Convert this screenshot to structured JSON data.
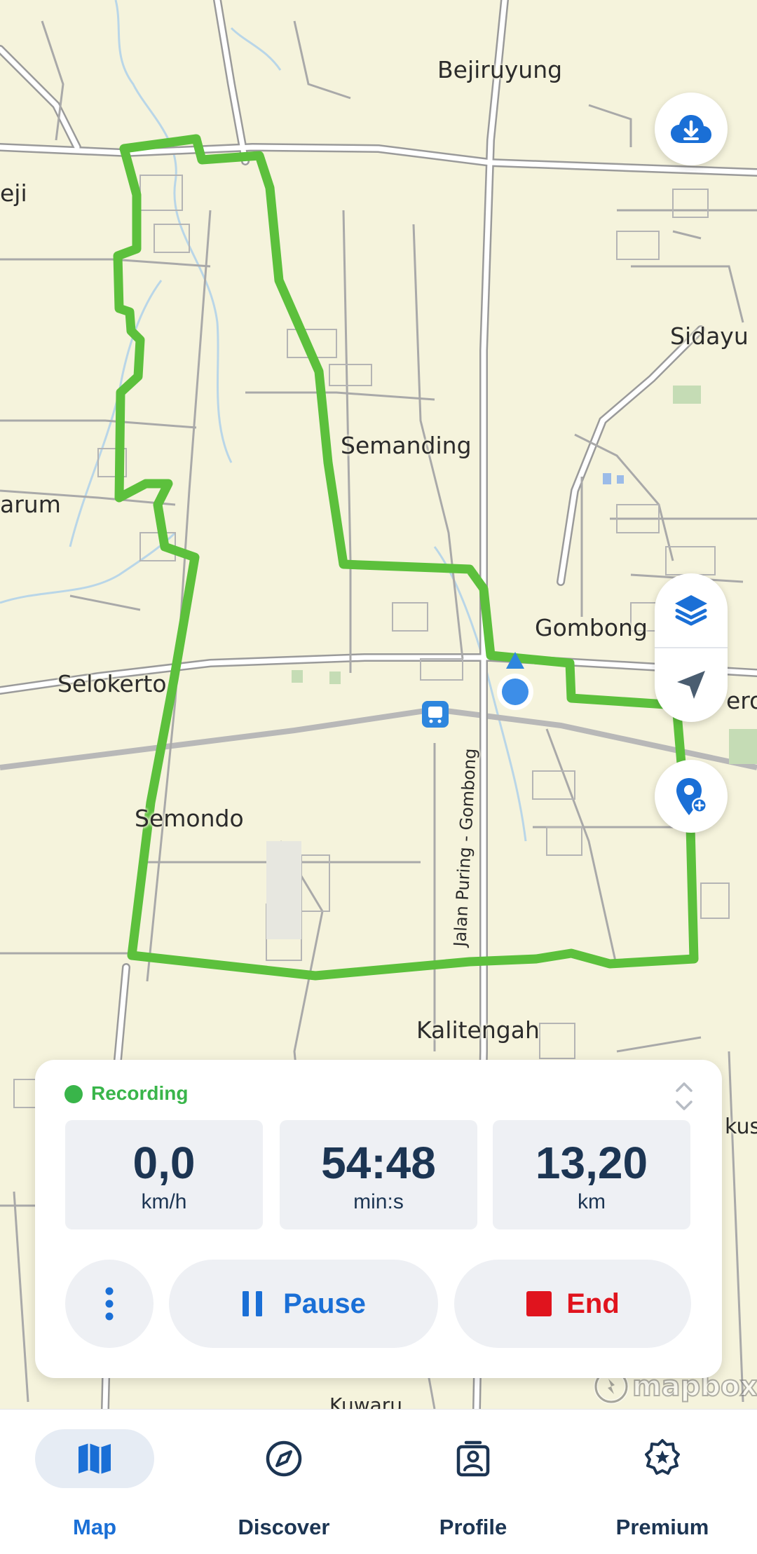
{
  "map": {
    "labels": {
      "bejiruyung": "Bejiruyung",
      "eji": "eji",
      "sidayu": "Sidayu",
      "semanding": "Semanding",
      "arum": "arum",
      "gombong": "Gombong",
      "selokerto": "Selokerto",
      "ero": "ero",
      "semondo": "Semondo",
      "jalan_puring": "Jalan Puring - Gombong",
      "kalitengah": "Kalitengah",
      "kus": "kus",
      "kuwaru": "Kuwaru"
    },
    "attribution": "mapbox",
    "route_color": "#5cc03c",
    "icons": {
      "download": "cloud-download-icon",
      "layers": "layers-icon",
      "locate": "navigation-arrow-icon",
      "add_poi": "add-location-pin-icon"
    }
  },
  "recording": {
    "status": "Recording",
    "status_color": "#39b54a",
    "stats": [
      {
        "value": "0,0",
        "unit": "km/h"
      },
      {
        "value": "54:48",
        "unit": "min:s"
      },
      {
        "value": "13,20",
        "unit": "km"
      }
    ],
    "pause_label": "Pause",
    "end_label": "End",
    "accent": "#1a6fd6",
    "end_color": "#e0141e"
  },
  "nav": {
    "items": [
      {
        "label": "Map",
        "icon": "map-icon",
        "active": true
      },
      {
        "label": "Discover",
        "icon": "compass-icon",
        "active": false
      },
      {
        "label": "Profile",
        "icon": "profile-badge-icon",
        "active": false
      },
      {
        "label": "Premium",
        "icon": "star-badge-icon",
        "active": false
      }
    ]
  }
}
